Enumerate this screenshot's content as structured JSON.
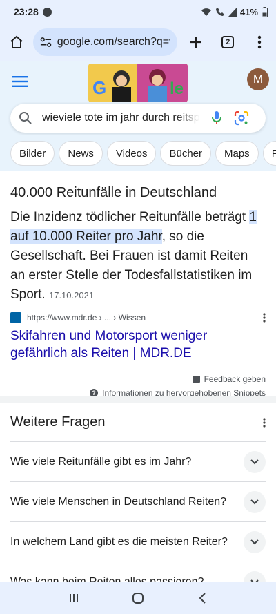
{
  "status_bar": {
    "time": "23:28",
    "battery": "41%",
    "icons": [
      "messenger-icon",
      "wifi-icon",
      "call-icon",
      "signal-icon",
      "battery-icon"
    ]
  },
  "browser": {
    "url": "google.com/search?q=w",
    "tab_count": "2",
    "icons": [
      "home-icon",
      "site-settings-icon",
      "new-tab-icon",
      "tabs-icon",
      "more-icon"
    ]
  },
  "google": {
    "avatar_letter": "M",
    "search_query": "wieviele tote im jahr durch reitsport",
    "chips": [
      "Bilder",
      "News",
      "Videos",
      "Bücher",
      "Maps",
      "Flüge"
    ]
  },
  "snippet": {
    "title": "40.000 Reitunfälle in Deutschland",
    "body_before": "Die Inzidenz tödlicher Reitunfälle beträgt ",
    "body_highlight": "1 auf 10.000 Reiter pro Jahr",
    "body_after": ", so die Gesellschaft. Bei Frauen ist damit Reiten an erster Stelle der Todesfallstatistiken im Sport.",
    "date": "17.10.2021",
    "source_url": "https://www.mdr.de › ... › Wissen",
    "link_title": "Skifahren und Motorsport weniger gefährlich als Reiten | MDR.DE",
    "feedback_label": "Feedback geben",
    "info_label": "Informationen zu hervorgehobenen Snippets"
  },
  "paa": {
    "title": "Weitere Fragen",
    "questions": [
      "Wie viele Reitunfälle gibt es im Jahr?",
      "Wie viele Menschen in Deutschland Reiten?",
      "In welchem Land gibt es die meisten Reiter?",
      "Was kann beim Reiten alles passieren?"
    ]
  },
  "navbar": {
    "icons": [
      "recents-icon",
      "home-nav-icon",
      "back-icon"
    ]
  },
  "colors": {
    "link": "#1a0dab",
    "highlight": "#d3e3fd",
    "header_bg": "#e8f3fc"
  }
}
